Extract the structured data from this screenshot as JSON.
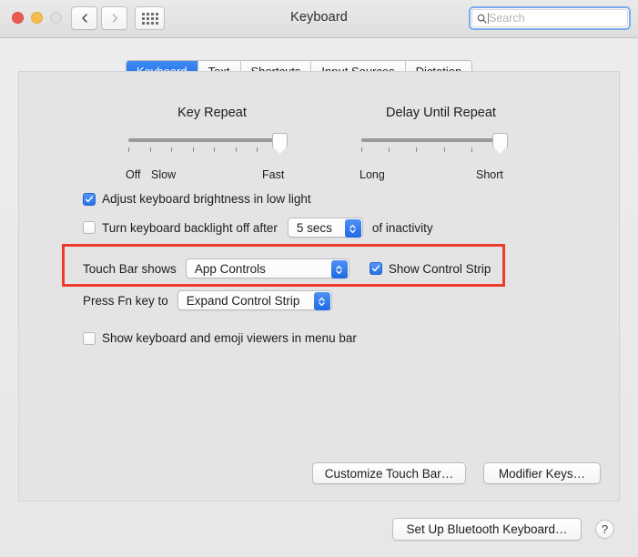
{
  "window": {
    "title": "Keyboard",
    "traffic_lights": [
      "close",
      "minimize",
      "zoom"
    ],
    "nav_back_icon": "chevron-left-icon",
    "nav_forward_icon": "chevron-right-icon",
    "show_all_icon": "grid-dots-icon"
  },
  "search": {
    "placeholder": "Search",
    "value": "",
    "icon": "search-icon"
  },
  "tabs": [
    {
      "label": "Keyboard",
      "active": true
    },
    {
      "label": "Text",
      "active": false
    },
    {
      "label": "Shortcuts",
      "active": false
    },
    {
      "label": "Input Sources",
      "active": false
    },
    {
      "label": "Dictation",
      "active": false
    }
  ],
  "sliders": [
    {
      "title": "Key Repeat",
      "left_label": "Off",
      "second_label": "Slow",
      "right_label": "Fast",
      "ticks": 8,
      "value_position": "100%"
    },
    {
      "title": "Delay Until Repeat",
      "left_label": "Long",
      "right_label": "Short",
      "ticks": 6,
      "value_position": "100%"
    }
  ],
  "options": {
    "adjust_brightness": {
      "label": "Adjust keyboard brightness in low light",
      "checked": true
    },
    "backlight_off": {
      "label": "Turn keyboard backlight off after",
      "checked": false,
      "stepper_value": "5 secs",
      "suffix": "of inactivity"
    },
    "touch_bar_shows": {
      "label": "Touch Bar shows",
      "value": "App Controls"
    },
    "show_control_strip": {
      "label": "Show Control Strip",
      "checked": true
    },
    "press_fn_key": {
      "label": "Press Fn key to",
      "value": "Expand Control Strip"
    },
    "show_viewers": {
      "label": "Show keyboard and emoji viewers in menu bar",
      "checked": false
    }
  },
  "buttons": {
    "customize_touch_bar": "Customize Touch Bar…",
    "modifier_keys": "Modifier Keys…",
    "set_up_bluetooth": "Set Up Bluetooth Keyboard…",
    "help": "?"
  },
  "annotation": {
    "color": "#ef3b2d",
    "target": "touch-bar-shows-row"
  }
}
